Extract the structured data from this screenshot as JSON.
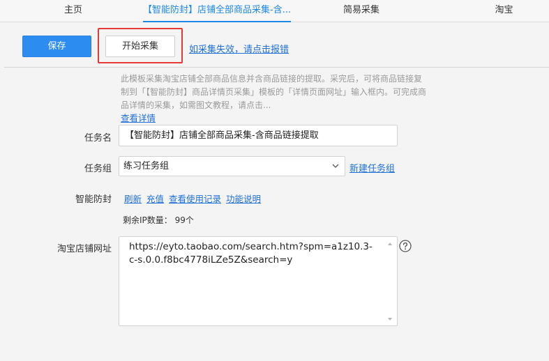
{
  "tabs": [
    {
      "label": "主页",
      "active": false
    },
    {
      "label": "【智能防封】店铺全部商品采集-含...",
      "active": true
    },
    {
      "label": "简易采集",
      "active": false
    },
    {
      "label": "淘宝",
      "active": false
    }
  ],
  "toolbar": {
    "save_label": "保存",
    "start_label": "开始采集",
    "report_link": "如采集失效，请点击报错"
  },
  "description": {
    "text": "此模板采集淘宝店铺全部商品信息并含商品链接的提取。采完后，可将商品链接复制到「【智能防封】商品详情页采集」模板的「详情页面网址」输入框内。可完成商品详情的采集，如需图文教程，请点击...",
    "detail_link": "查看详情"
  },
  "form": {
    "task_name": {
      "label": "任务名",
      "value": "【智能防封】店铺全部商品采集-含商品链接提取"
    },
    "task_group": {
      "label": "任务组",
      "value": "练习任务组",
      "new_link": "新建任务组"
    },
    "smart": {
      "label": "智能防封",
      "links": [
        "刷新",
        "充值",
        "查看使用记录",
        "功能说明"
      ],
      "ip_count": "剩余IP数量： 99个"
    },
    "shop_url": {
      "label": "淘宝店铺网址",
      "value": "https://eyto.taobao.com/search.htm?spm=a1z10.3-c-s.0.0.f8bc4778iLZe5Z&search=y"
    }
  },
  "colors": {
    "accent": "#2d8cf0",
    "link": "#1e6fd9",
    "highlight": "#e53935"
  }
}
